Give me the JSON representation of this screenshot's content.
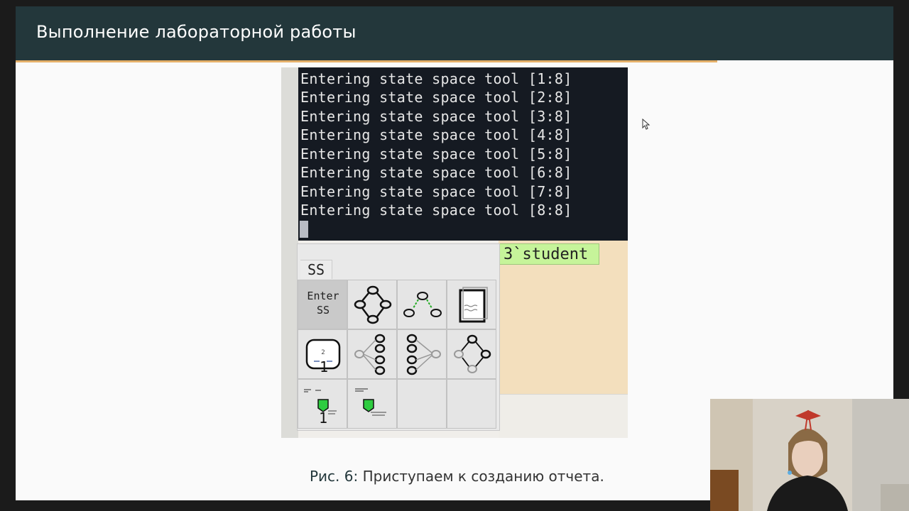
{
  "slide": {
    "title": "Выполнение лабораторной работы"
  },
  "terminal": {
    "lines": [
      "Entering state space tool [1:8]",
      "Entering state space tool [2:8]",
      "Entering state space tool [3:8]",
      "Entering state space tool [4:8]",
      "Entering state space tool [5:8]",
      "Entering state space tool [6:8]",
      "Entering state space tool [7:8]",
      "Entering state space tool [8:8]"
    ]
  },
  "binder": {
    "label": "3`student"
  },
  "palette": {
    "tab": "SS",
    "enter_label_1": "Enter",
    "enter_label_2": "SS",
    "digit_1": "1",
    "digit_2": "1"
  },
  "caption": {
    "prefix": "Рис. 6:",
    "text": " Приступаем к созданию отчета."
  },
  "colors": {
    "header_bg": "#23373b",
    "accent_rule": "#e4b06a",
    "terminal_bg": "#151a22",
    "binder_label_bg": "#c6f49a",
    "desk_bg": "#f3dfbd"
  },
  "icons": [
    "state-space-graph-icon",
    "node-branch-icon",
    "report-page-icon",
    "scc-node-icon",
    "scc-graph-icon",
    "scc-graph-alt-icon",
    "state-graph-icon",
    "eval-node-icon",
    "eval-node-alt-icon",
    "mouse-pointer-icon"
  ]
}
